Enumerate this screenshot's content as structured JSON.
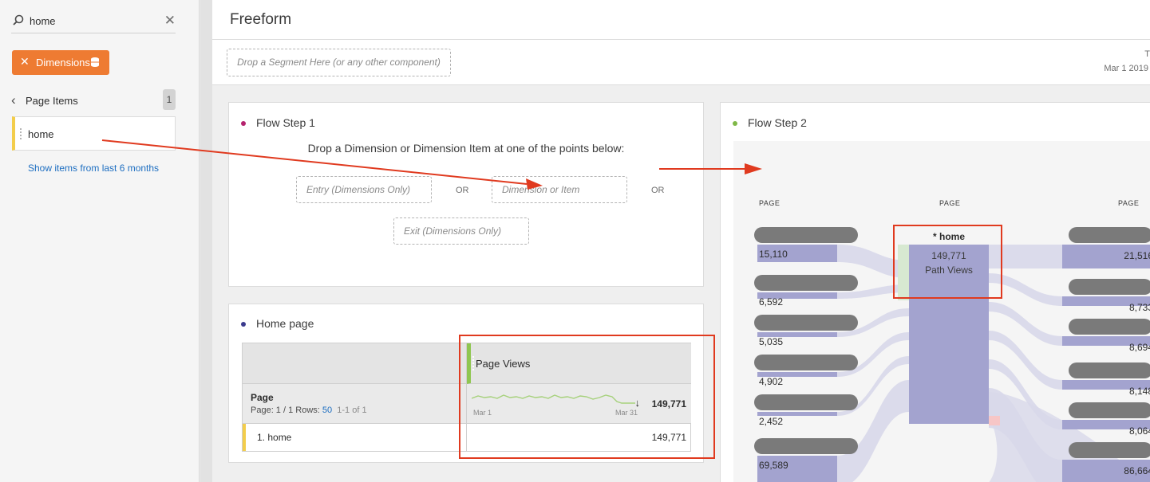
{
  "sidebar": {
    "search_value": "home",
    "filter_chip": "Dimensions",
    "breadcrumb": "Page Items",
    "count": "1",
    "item": "home",
    "show_items_link": "Show items from last 6 months"
  },
  "header": {
    "title": "Freeform",
    "drop_segment": "Drop a Segment Here (or any other component)",
    "date_range_top": "T",
    "date_range": "Mar 1 2019"
  },
  "flow_step_1": {
    "title": "Flow Step 1",
    "instruction": "Drop a Dimension or Dimension Item at one of the points below:",
    "entry": "Entry (Dimensions Only)",
    "dimension": "Dimension or Item",
    "exit": "Exit (Dimensions Only)",
    "or1": "OR",
    "or2": "OR"
  },
  "home_page": {
    "title": "Home page",
    "metric": "Page Views",
    "dimension": "Page",
    "pagination_prefix": "Page: 1 / 1  Rows: ",
    "rows": "50",
    "range": "1-1 of 1",
    "axis_start": "Mar 1",
    "axis_end": "Mar 31",
    "total": "149,771",
    "row_label": "1. home",
    "row_value": "149,771"
  },
  "flow_step_2": {
    "title": "Flow Step 2",
    "col_left": "PAGE",
    "col_center": "PAGE",
    "col_right": "PAGE",
    "center_node": {
      "name": "* home",
      "value": "149,771",
      "unit": "Path Views"
    },
    "left_nodes": [
      "15,110",
      "6,592",
      "5,035",
      "4,902",
      "2,452",
      "69,589"
    ],
    "right_nodes": [
      "21,516",
      "8,733",
      "8,694",
      "8,148",
      "8,064",
      "86,664"
    ]
  },
  "colors": {
    "accent_orange": "#ee7b32",
    "annotation_red": "#e03a1f",
    "flow_node": "#a3a3cf",
    "flow_link": "#d8d8ea",
    "metric_green": "#8fc651",
    "item_yellow": "#f3cd4b"
  }
}
